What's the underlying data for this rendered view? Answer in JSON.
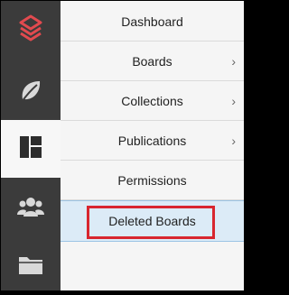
{
  "sidebar": {
    "items": [
      {
        "icon": "app-logo-icon",
        "active": false
      },
      {
        "icon": "leaf-icon",
        "active": false
      },
      {
        "icon": "dashboard-grid-icon",
        "active": true
      },
      {
        "icon": "users-group-icon",
        "active": false
      },
      {
        "icon": "folder-icon",
        "active": false
      }
    ],
    "colors": {
      "rail": "#3b3b3b",
      "logo": "#e24a4f",
      "icon": "#d9d9d9",
      "active_icon": "#2d2d2d"
    }
  },
  "menu": {
    "items": [
      {
        "label": "Dashboard",
        "has_submenu": false
      },
      {
        "label": "Boards",
        "has_submenu": true,
        "chevron": "›"
      },
      {
        "label": "Collections",
        "has_submenu": true,
        "chevron": "›"
      },
      {
        "label": "Publications",
        "has_submenu": true,
        "chevron": "›"
      },
      {
        "label": "Permissions",
        "has_submenu": false
      },
      {
        "label": "Deleted Boards",
        "has_submenu": false,
        "selected": true
      }
    ],
    "highlight_color": "#d8262f"
  }
}
